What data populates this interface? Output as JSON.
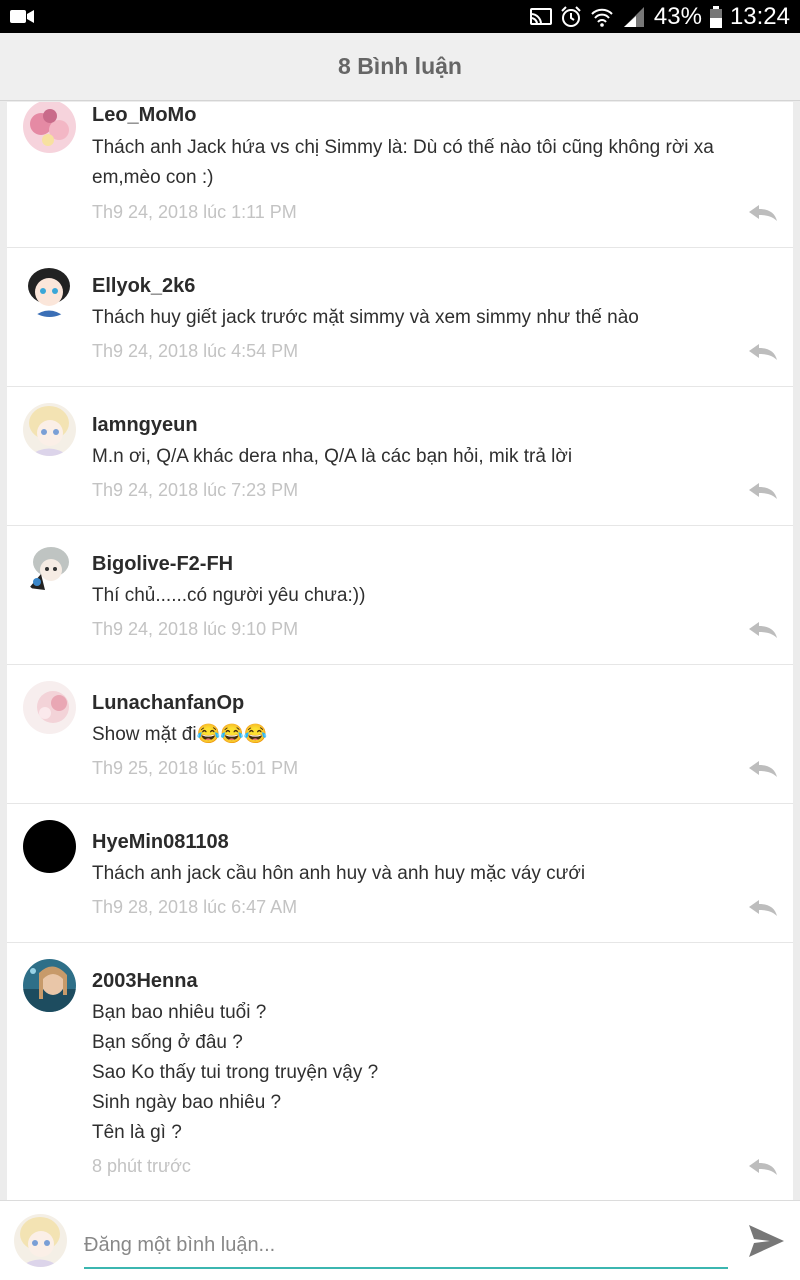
{
  "status_bar": {
    "battery": "43%",
    "time": "13:24"
  },
  "header": {
    "title": "8 Bình luận"
  },
  "comments": [
    {
      "username": "Leo_MoMo",
      "lines": [
        "Thách anh Jack hứa vs chị Simmy là: Dù có thế nào tôi cũng không rời xa",
        "em,mèo con :)"
      ],
      "time": "Th9 24, 2018 lúc 1:11 PM"
    },
    {
      "username": "Ellyok_2k6",
      "lines": [
        "Thách huy giết jack trước mặt simmy và xem simmy như thế nào"
      ],
      "time": "Th9 24, 2018 lúc 4:54 PM"
    },
    {
      "username": "Iamngyeun",
      "lines": [
        "M.n ơi, Q/A khác dera nha, Q/A là các bạn hỏi, mik trả lời"
      ],
      "time": "Th9 24, 2018 lúc 7:23 PM"
    },
    {
      "username": "Bigolive-F2-FH",
      "lines": [
        "Thí chủ......có người yêu chưa:))"
      ],
      "time": "Th9 24, 2018 lúc 9:10 PM"
    },
    {
      "username": "LunachanfanOp",
      "lines": [
        "Show mặt đi😂😂😂"
      ],
      "time": "Th9 25, 2018 lúc 5:01 PM"
    },
    {
      "username": "HyeMin081108",
      "lines": [
        "Thách anh jack cầu hôn anh huy và anh huy mặc váy cưới"
      ],
      "time": "Th9 28, 2018 lúc 6:47 AM"
    },
    {
      "username": "2003Henna",
      "lines": [
        "Bạn bao nhiêu tuổi ?",
        "Bạn sống ở đâu ?",
        "Sao Ko thấy tui trong truyện vậy ?",
        "Sinh ngày bao nhiêu ?",
        "Tên là gì ?"
      ],
      "time": "8 phút trước"
    }
  ],
  "composer": {
    "placeholder": "Đăng một bình luận..."
  },
  "icons": {
    "reply": "reply-icon",
    "send": "send-icon"
  },
  "colors": {
    "accent": "#3bb6b0"
  }
}
